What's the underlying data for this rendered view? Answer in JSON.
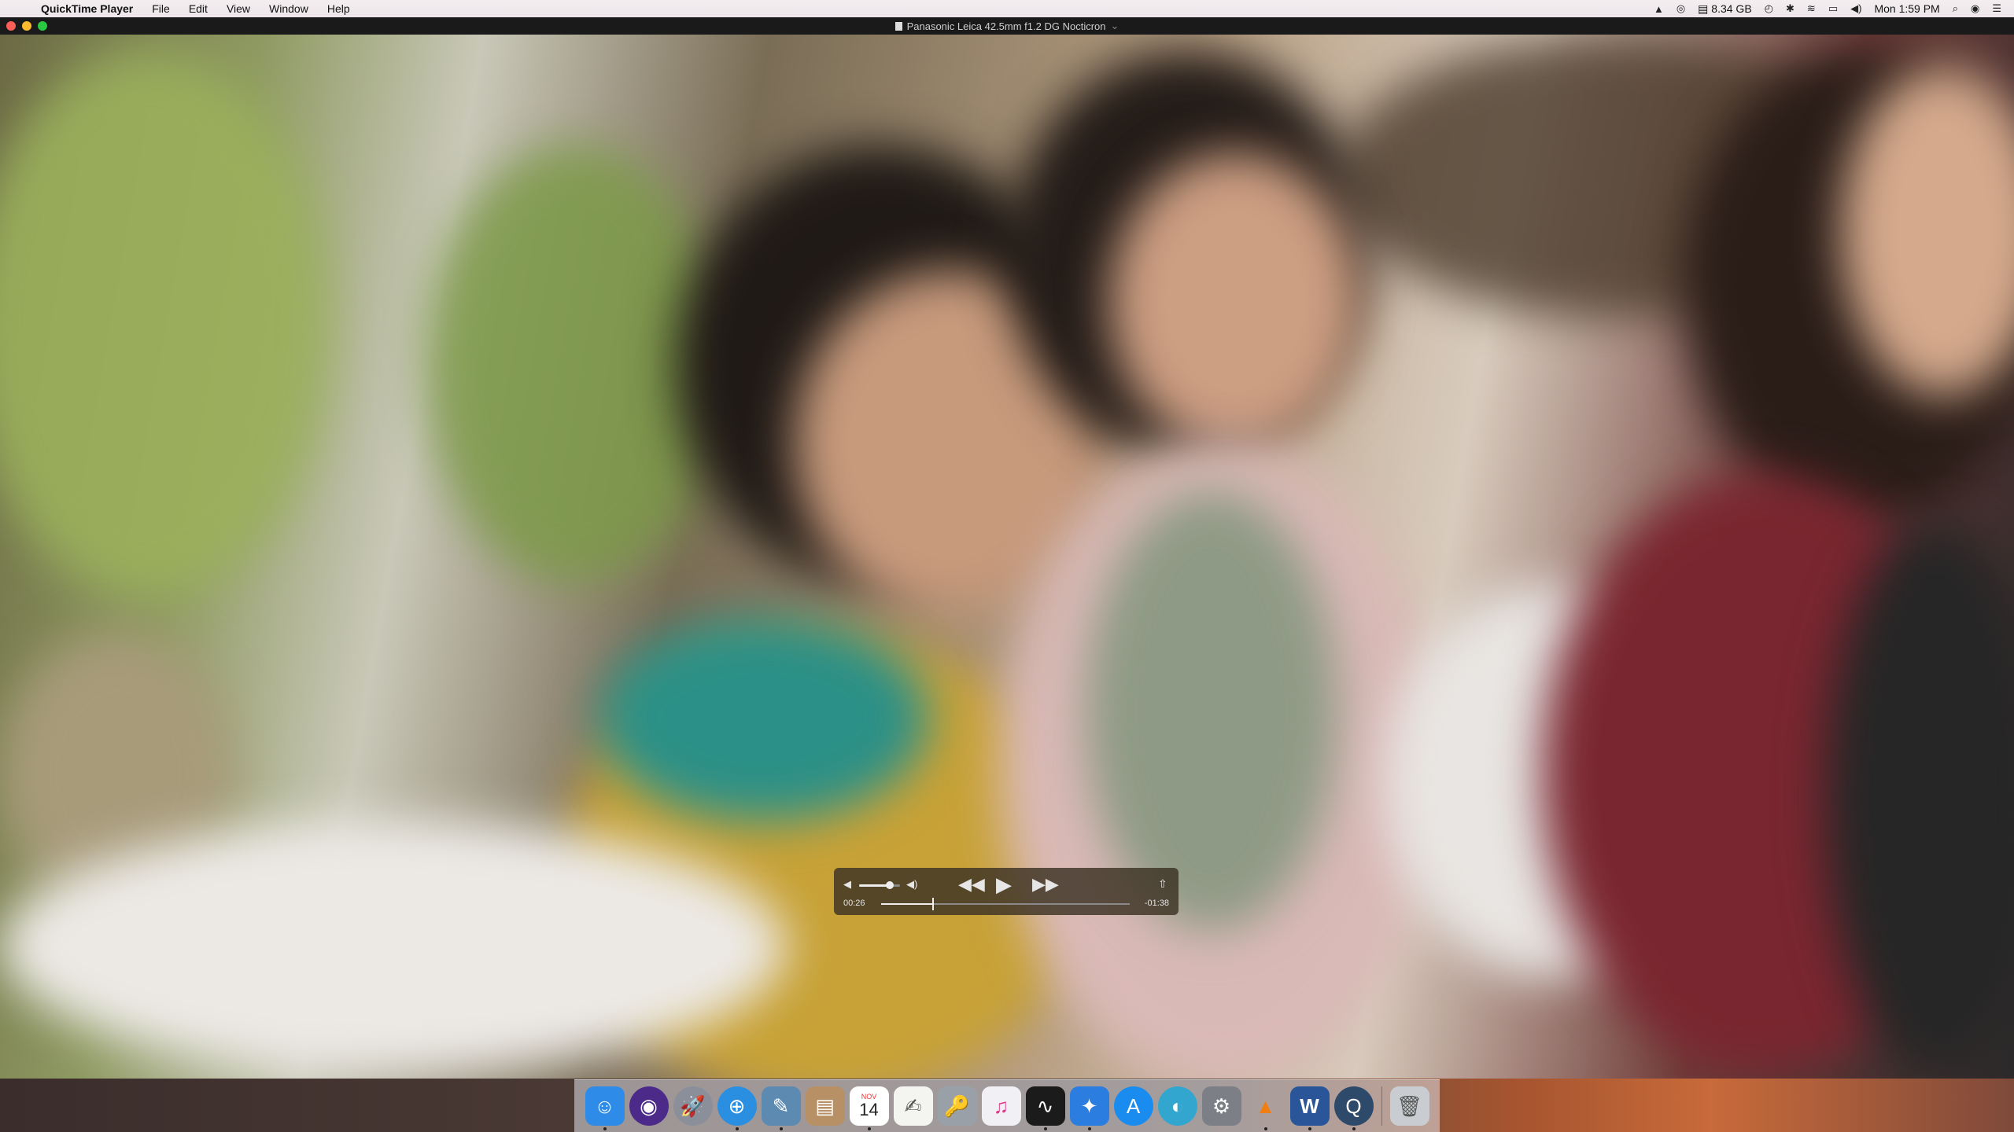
{
  "menubar": {
    "apple": "",
    "app_name": "QuickTime Player",
    "items": [
      "File",
      "Edit",
      "View",
      "Window",
      "Help"
    ],
    "memory": "8.34 GB",
    "clock": "Mon 1:59 PM"
  },
  "window": {
    "title": "Panasonic Leica 42.5mm f1.2 DG Nocticron",
    "title_chevron": "⌄"
  },
  "player": {
    "elapsed": "00:26",
    "remaining": "-01:38",
    "progress": 0.21,
    "volume": 0.75
  },
  "dock": {
    "calendar_month": "NOV",
    "calendar_day": "14",
    "word_letter": "W",
    "items": [
      {
        "name": "finder",
        "bg": "#2f8be8",
        "glyph": "☺"
      },
      {
        "name": "siri",
        "bg": "#4b2a8a",
        "glyph": "◉"
      },
      {
        "name": "launchpad",
        "bg": "#8a8f99",
        "glyph": "🚀"
      },
      {
        "name": "safari",
        "bg": "#2a8fe0",
        "glyph": "⊕"
      },
      {
        "name": "preview",
        "bg": "#5d8ab0",
        "glyph": "✎"
      },
      {
        "name": "contacts",
        "bg": "#b89066",
        "glyph": "▤"
      },
      {
        "name": "calendar",
        "bg": "#ffffff",
        "glyph": ""
      },
      {
        "name": "textedit",
        "bg": "#f4f4f0",
        "glyph": "✍"
      },
      {
        "name": "keychain",
        "bg": "#9aa0a8",
        "glyph": "🔑"
      },
      {
        "name": "itunes",
        "bg": "#f0f0f5",
        "glyph": "♫"
      },
      {
        "name": "activity-monitor",
        "bg": "#1b1b1b",
        "glyph": "∿"
      },
      {
        "name": "xcode-like",
        "bg": "#2b7de0",
        "glyph": "✦"
      },
      {
        "name": "app-store",
        "bg": "#1a8cf0",
        "glyph": "A"
      },
      {
        "name": "disk-utility",
        "bg": "#33a6cf",
        "glyph": "◐"
      },
      {
        "name": "system-preferences",
        "bg": "#7c7f86",
        "glyph": "⚙"
      },
      {
        "name": "vlc",
        "bg": "transparent",
        "glyph": "▲"
      },
      {
        "name": "word",
        "bg": "#2a5699",
        "glyph": ""
      },
      {
        "name": "quicktime",
        "bg": "#2e4a6b",
        "glyph": "Q"
      },
      {
        "name": "trash",
        "bg": "#c9ccd1",
        "glyph": "🗑"
      }
    ]
  }
}
